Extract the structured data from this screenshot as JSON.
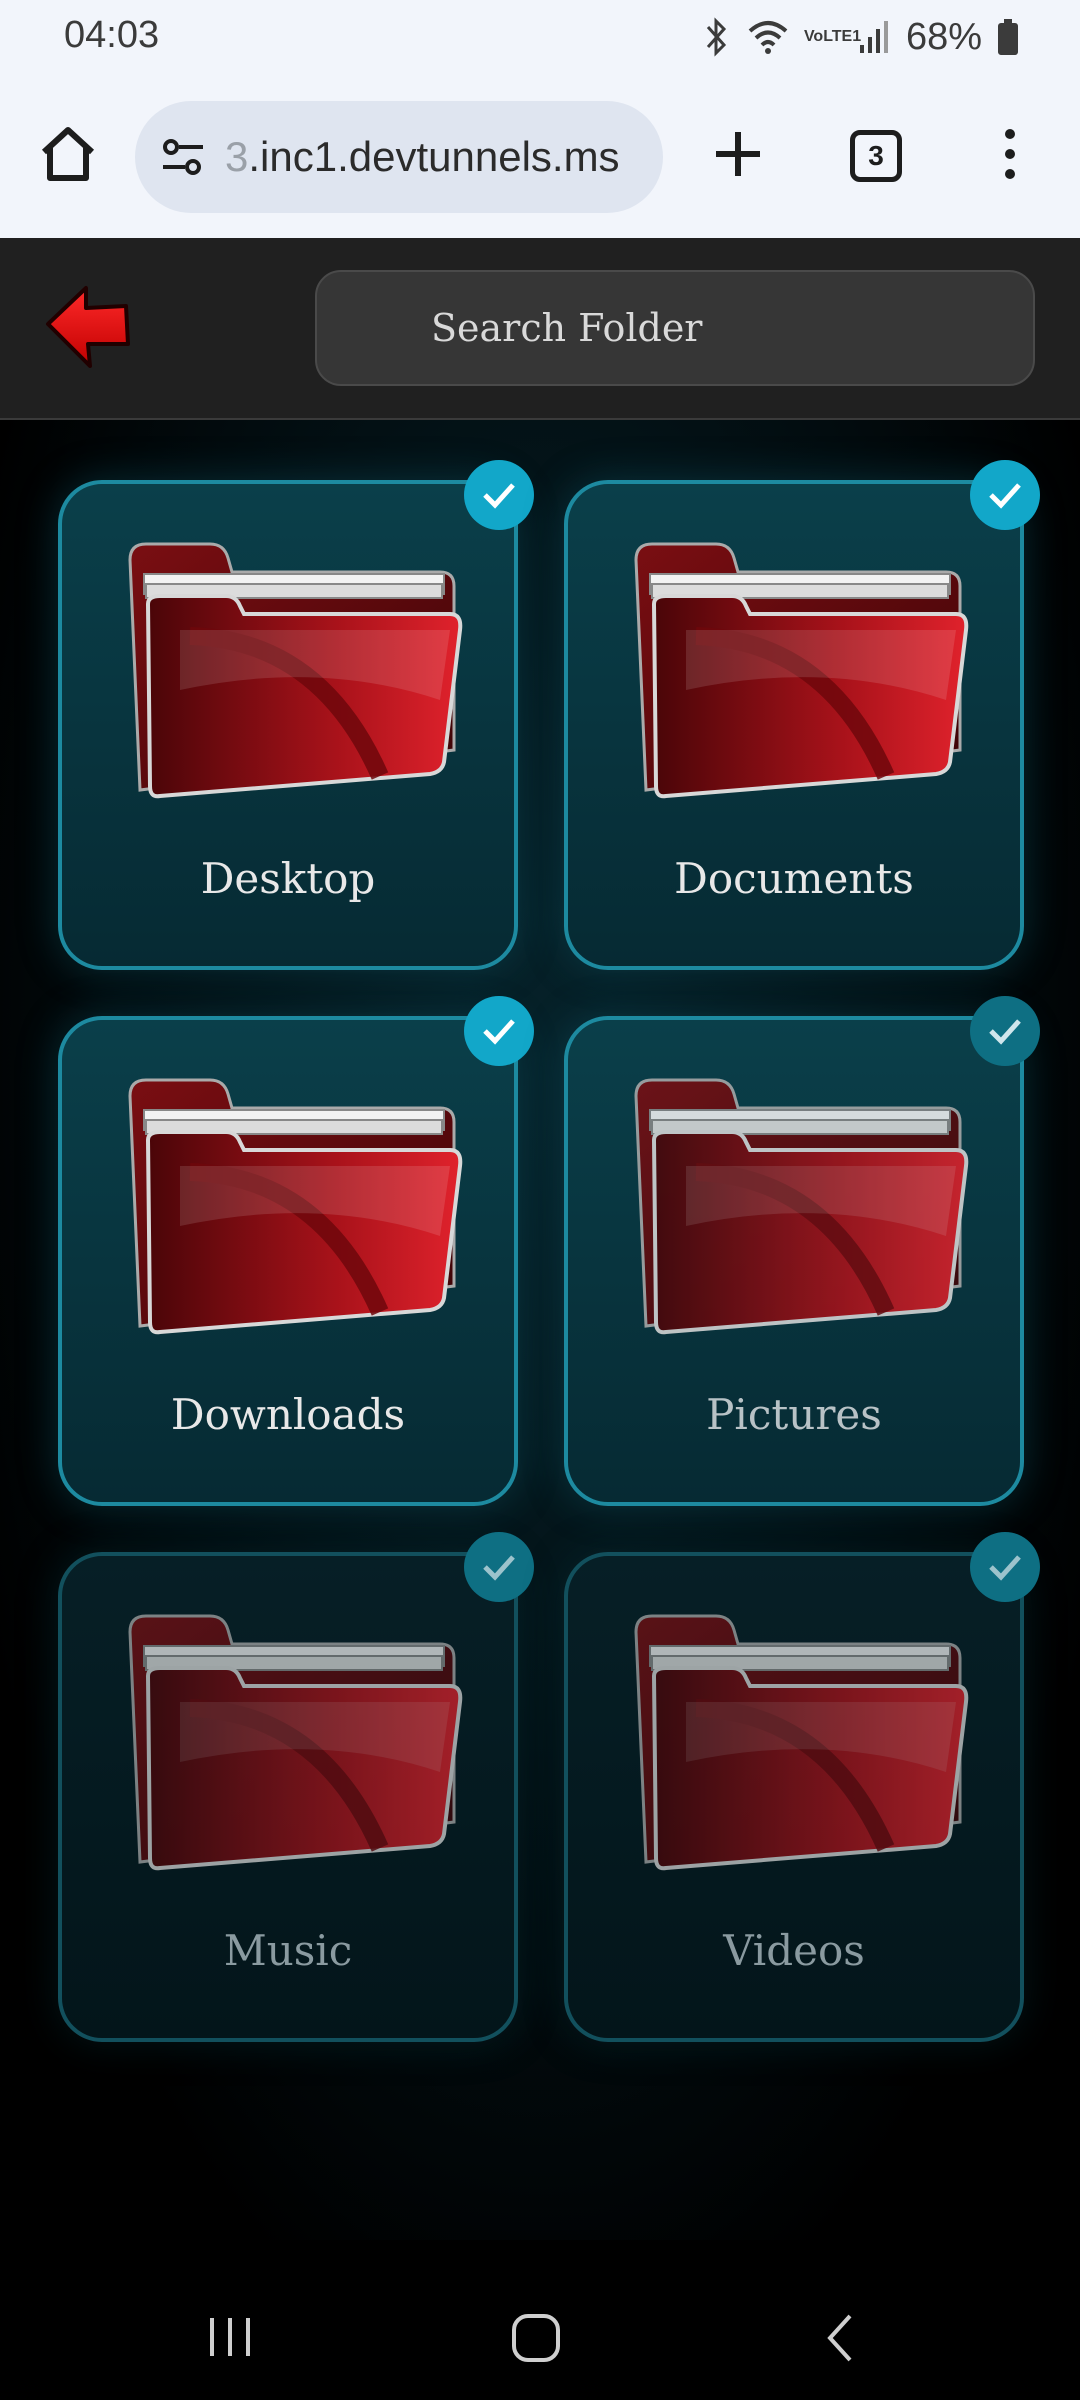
{
  "status": {
    "time": "04:03",
    "battery": "68%",
    "network_label": "VoLTE1"
  },
  "browser": {
    "url_faded": "3",
    "url": ".inc1.devtunnels.ms",
    "tab_count": "3"
  },
  "header": {
    "search_placeholder": "Search Folder"
  },
  "folders": [
    {
      "label": "Desktop",
      "checked": true
    },
    {
      "label": "Documents",
      "checked": true
    },
    {
      "label": "Downloads",
      "checked": true
    },
    {
      "label": "Pictures",
      "checked": true
    },
    {
      "label": "Music",
      "checked": true
    },
    {
      "label": "Videos",
      "checked": true
    }
  ],
  "colors": {
    "accent": "#12a7c9",
    "card_border": "#1d8aa0",
    "folder_red": "#c0141c"
  }
}
